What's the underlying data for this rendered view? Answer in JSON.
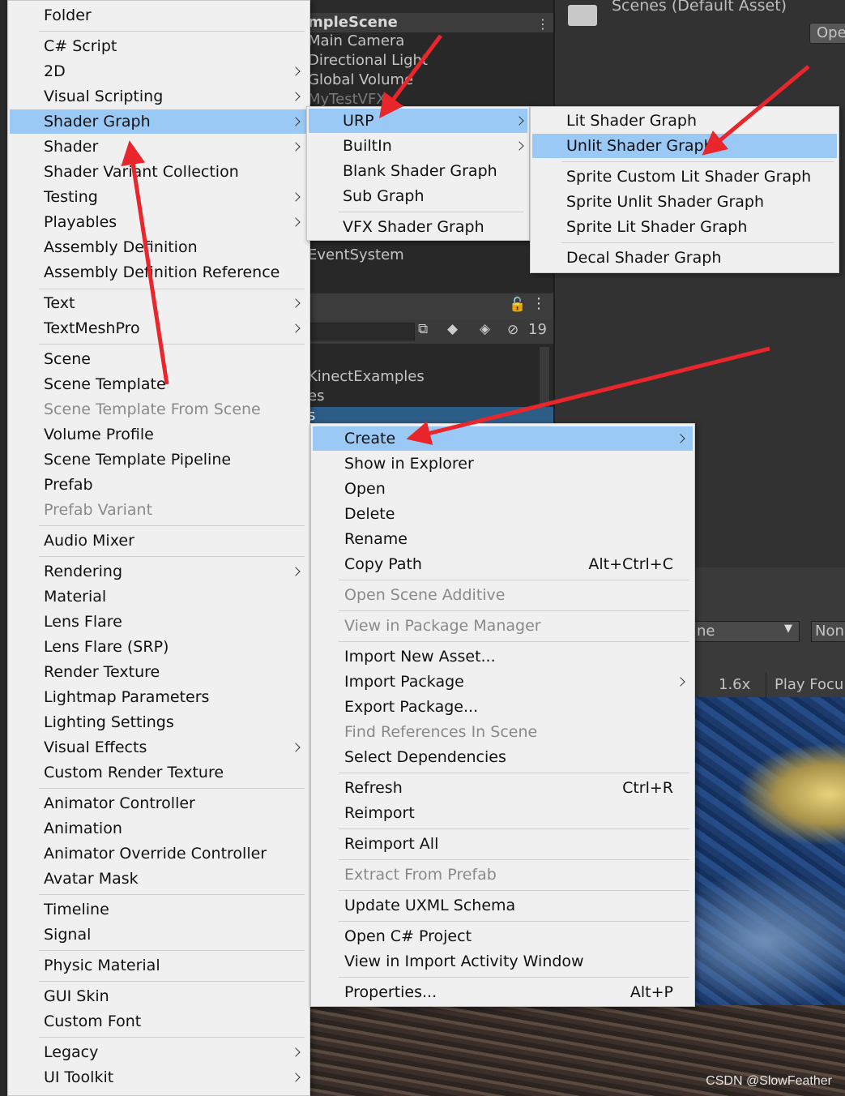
{
  "background": {
    "hierarchy": {
      "scene": "mpleScene",
      "objects": [
        "Main Camera",
        "Directional Light",
        "Global Volume",
        "MyTestVFX"
      ],
      "eventsystem": "EventSystem"
    },
    "inspector": {
      "title": "Scenes (Default Asset)",
      "open_button": "Ope"
    },
    "project": {
      "hidden_count": "19",
      "items": [
        "KinectExamples",
        "es",
        "s"
      ]
    },
    "game": {
      "dropdown": "ne",
      "toggle": "Non",
      "scale": "1.6x",
      "play_focus": "Play Focu"
    }
  },
  "menus": {
    "create": {
      "items": [
        {
          "label": "Folder"
        },
        {
          "label": "C# Script"
        },
        {
          "label": "2D",
          "submenu": true
        },
        {
          "label": "Visual Scripting",
          "submenu": true
        },
        {
          "label": "Shader Graph",
          "submenu": true,
          "selected": true
        },
        {
          "label": "Shader",
          "submenu": true
        },
        {
          "label": "Shader Variant Collection"
        },
        {
          "label": "Testing",
          "submenu": true
        },
        {
          "label": "Playables",
          "submenu": true
        },
        {
          "label": "Assembly Definition"
        },
        {
          "label": "Assembly Definition Reference"
        },
        {
          "label": "Text",
          "submenu": true
        },
        {
          "label": "TextMeshPro",
          "submenu": true
        },
        {
          "label": "Scene"
        },
        {
          "label": "Scene Template"
        },
        {
          "label": "Scene Template From Scene",
          "disabled": true
        },
        {
          "label": "Volume Profile"
        },
        {
          "label": "Scene Template Pipeline"
        },
        {
          "label": "Prefab"
        },
        {
          "label": "Prefab Variant",
          "disabled": true
        },
        {
          "label": "Audio Mixer"
        },
        {
          "label": "Rendering",
          "submenu": true
        },
        {
          "label": "Material"
        },
        {
          "label": "Lens Flare"
        },
        {
          "label": "Lens Flare (SRP)"
        },
        {
          "label": "Render Texture"
        },
        {
          "label": "Lightmap Parameters"
        },
        {
          "label": "Lighting Settings"
        },
        {
          "label": "Visual Effects",
          "submenu": true
        },
        {
          "label": "Custom Render Texture"
        },
        {
          "label": "Animator Controller"
        },
        {
          "label": "Animation"
        },
        {
          "label": "Animator Override Controller"
        },
        {
          "label": "Avatar Mask"
        },
        {
          "label": "Timeline"
        },
        {
          "label": "Signal"
        },
        {
          "label": "Physic Material"
        },
        {
          "label": "GUI Skin"
        },
        {
          "label": "Custom Font"
        },
        {
          "label": "Legacy",
          "submenu": true
        },
        {
          "label": "UI Toolkit",
          "submenu": true
        }
      ]
    },
    "shader_graph": {
      "items": [
        {
          "label": "URP",
          "submenu": true,
          "selected": true
        },
        {
          "label": "BuiltIn",
          "submenu": true
        },
        {
          "label": "Blank Shader Graph"
        },
        {
          "label": "Sub Graph"
        },
        {
          "label": "VFX Shader Graph"
        }
      ]
    },
    "urp": {
      "items": [
        {
          "label": "Lit Shader Graph"
        },
        {
          "label": "Unlit Shader Graph",
          "selected": true
        },
        {
          "label": "Sprite Custom Lit Shader Graph"
        },
        {
          "label": "Sprite Unlit Shader Graph"
        },
        {
          "label": "Sprite Lit Shader Graph"
        },
        {
          "label": "Decal Shader Graph"
        }
      ]
    },
    "context": {
      "items": [
        {
          "label": "Create",
          "submenu": true,
          "selected": true
        },
        {
          "label": "Show in Explorer"
        },
        {
          "label": "Open"
        },
        {
          "label": "Delete"
        },
        {
          "label": "Rename"
        },
        {
          "label": "Copy Path",
          "shortcut": "Alt+Ctrl+C"
        },
        {
          "label": "Open Scene Additive",
          "disabled": true
        },
        {
          "label": "View in Package Manager",
          "disabled": true
        },
        {
          "label": "Import New Asset..."
        },
        {
          "label": "Import Package",
          "submenu": true
        },
        {
          "label": "Export Package..."
        },
        {
          "label": "Find References In Scene",
          "disabled": true
        },
        {
          "label": "Select Dependencies"
        },
        {
          "label": "Refresh",
          "shortcut": "Ctrl+R"
        },
        {
          "label": "Reimport"
        },
        {
          "label": "Reimport All"
        },
        {
          "label": "Extract From Prefab",
          "disabled": true
        },
        {
          "label": "Update UXML Schema"
        },
        {
          "label": "Open C# Project"
        },
        {
          "label": "View in Import Activity Window"
        },
        {
          "label": "Properties...",
          "shortcut": "Alt+P"
        }
      ]
    }
  },
  "watermark": "CSDN @SlowFeather",
  "colors": {
    "menu_bg": "#f0f0f0",
    "highlight": "#99c9f4",
    "annotation": "#e8262c"
  }
}
